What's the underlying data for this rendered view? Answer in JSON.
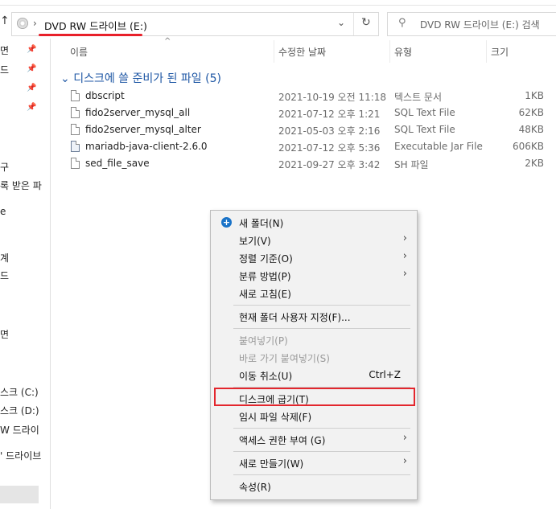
{
  "address": {
    "path_label": "DVD RW 드라이브 (E:)",
    "search_placeholder": "DVD RW 드라이브 (E:) 검색",
    "chevron": "›",
    "dropdown": "⌄",
    "refresh": "↻",
    "up_arrow": "↑"
  },
  "nav": {
    "items": [
      "면",
      "드",
      "구",
      "록 받은 파",
      "e",
      "계",
      "드",
      "면",
      "스크 (C:)",
      "스크 (D:)",
      "W 드라이",
      "' 드라이브"
    ]
  },
  "columns": {
    "name": "이름",
    "date": "수정한 날짜",
    "type": "유형",
    "size": "크기"
  },
  "group": {
    "label": "디스크에 쓸 준비가 된 파일 (5)",
    "chevron": "⌄"
  },
  "files": [
    {
      "name": "dbscript",
      "date": "2021-10-19 오전 11:18",
      "type": "텍스트 문서",
      "size": "1KB",
      "icon": "text-file-icon"
    },
    {
      "name": "fido2server_mysql_all",
      "date": "2021-07-12 오후 1:21",
      "type": "SQL Text File",
      "size": "62KB",
      "icon": "file-icon"
    },
    {
      "name": "fido2server_mysql_alter",
      "date": "2021-05-03 오후 2:16",
      "type": "SQL Text File",
      "size": "48KB",
      "icon": "file-icon"
    },
    {
      "name": "mariadb-java-client-2.6.0",
      "date": "2021-07-12 오후 5:36",
      "type": "Executable Jar File",
      "size": "606KB",
      "icon": "jar-file-icon"
    },
    {
      "name": "sed_file_save",
      "date": "2021-09-27 오후 3:42",
      "type": "SH 파일",
      "size": "2KB",
      "icon": "file-icon"
    }
  ],
  "menu": {
    "new_folder": "새 폴더(N)",
    "view": "보기(V)",
    "sort_by": "정렬 기준(O)",
    "group_by": "분류 방법(P)",
    "refresh": "새로 고침(E)",
    "customize": "현재 폴더 사용자 지정(F)...",
    "paste": "붙여넣기(P)",
    "paste_shortcut": "바로 가기 붙여넣기(S)",
    "undo_move": "이동 취소(U)",
    "undo_shortcut": "Ctrl+Z",
    "burn_to_disc": "디스크에 굽기(T)",
    "delete_temp": "임시 파일 삭제(F)",
    "give_access": "액세스 권한 부여 (G)",
    "new": "새로 만들기(W)",
    "properties": "속성(R)",
    "submenu_arrow": "›"
  },
  "colors": {
    "accent_red": "#e3262d",
    "group_blue": "#1d56a4",
    "menu_bg": "#f2f2f2"
  }
}
